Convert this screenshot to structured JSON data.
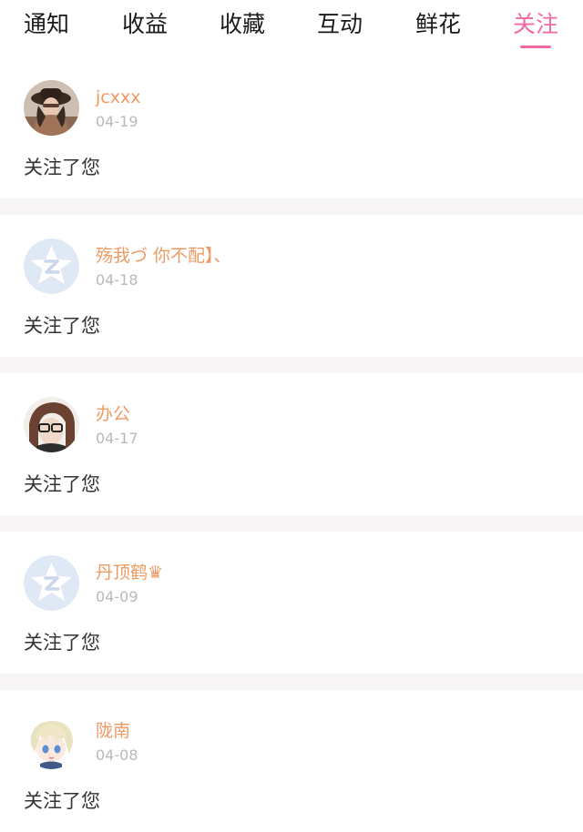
{
  "colors": {
    "accent": "#ef6aa0",
    "username": "#ee9a63",
    "date": "#b9b9b9",
    "text": "#333333",
    "separator": "#f8f5f6"
  },
  "tabs": [
    {
      "label": "通知",
      "active": false
    },
    {
      "label": "收益",
      "active": false
    },
    {
      "label": "收藏",
      "active": false
    },
    {
      "label": "互动",
      "active": false
    },
    {
      "label": "鲜花",
      "active": false
    },
    {
      "label": "关注",
      "active": true
    }
  ],
  "notifications": [
    {
      "username": "jcxxx",
      "date": "04-19",
      "message": "关注了您",
      "avatar": "photo-woman-hat"
    },
    {
      "username": "殇我づ 你不配】、",
      "date": "04-18",
      "message": "关注了您",
      "avatar": "default-star-avatar"
    },
    {
      "username": "办公",
      "date": "04-17",
      "message": "关注了您",
      "avatar": "photo-man-glasses"
    },
    {
      "username": "丹顶鹤♛",
      "date": "04-09",
      "message": "关注了您",
      "avatar": "default-star-avatar"
    },
    {
      "username": "陇南",
      "date": "04-08",
      "message": "关注了您",
      "avatar": "anime-boy-avatar"
    }
  ]
}
